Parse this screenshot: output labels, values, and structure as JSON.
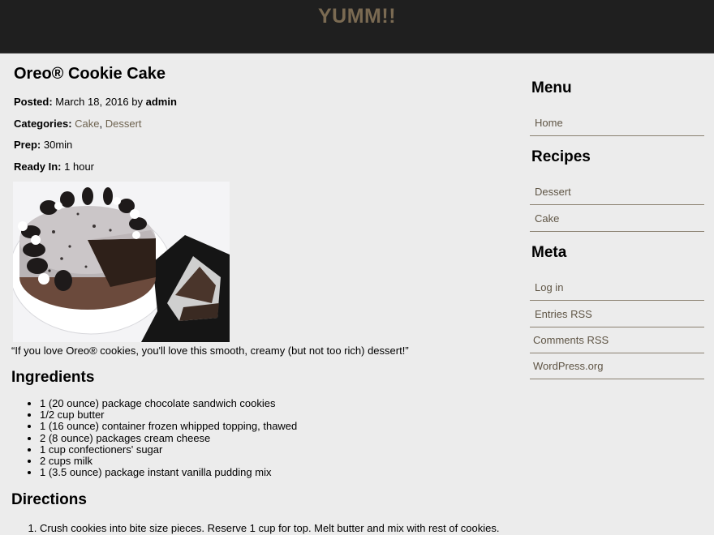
{
  "site": {
    "title": "YUMM!!"
  },
  "post": {
    "title": "Oreo® Cookie Cake",
    "posted_label": "Posted:",
    "posted_date": "March 18, 2016",
    "by": "by",
    "author": "admin",
    "categories_label": "Categories:",
    "categories": [
      "Cake",
      "Dessert"
    ],
    "prep_label": "Prep:",
    "prep_value": "30min",
    "ready_label": "Ready In:",
    "ready_value": "1 hour",
    "quote": "“If you love Oreo® cookies, you'll love this smooth, creamy (but not too rich) dessert!”",
    "ingredients_heading": "Ingredients",
    "ingredients": [
      "1 (20 ounce) package chocolate sandwich cookies",
      "1/2 cup butter",
      "1 (16 ounce) container frozen whipped topping, thawed",
      "2 (8 ounce) packages cream cheese",
      "1 cup confectioners' sugar",
      "2 cups milk",
      "1 (3.5 ounce) package instant vanilla pudding mix"
    ],
    "directions_heading": "Directions",
    "directions": [
      "Crush cookies into bite size pieces. Reserve 1 cup for top. Melt butter and mix with rest of cookies. Press"
    ]
  },
  "sidebar": {
    "menu_heading": "Menu",
    "menu_items": [
      "Home"
    ],
    "recipes_heading": "Recipes",
    "recipes_items": [
      "Dessert",
      "Cake"
    ],
    "meta_heading": "Meta",
    "meta_items": [
      "Log in",
      "Entries RSS",
      "Comments RSS",
      "WordPress.org"
    ]
  },
  "colors": {
    "header_bg": "#1f1f1f",
    "title": "#7a6a52",
    "link": "#6e6350",
    "page_bg": "#ececec"
  }
}
